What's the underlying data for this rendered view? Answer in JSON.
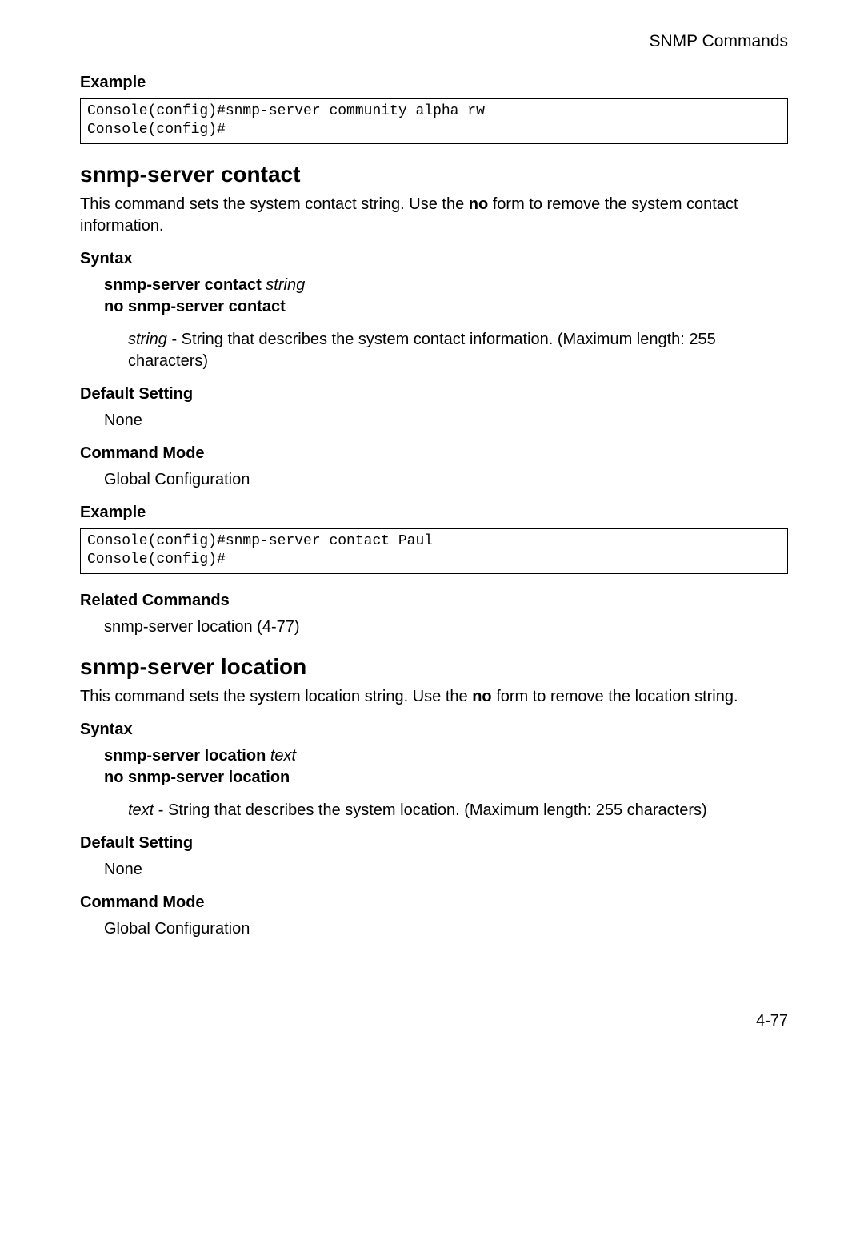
{
  "header": "SNMP Commands",
  "example1_heading": "Example",
  "example1_code": "Console(config)#snmp-server community alpha rw\nConsole(config)#",
  "contact": {
    "title": "snmp-server contact",
    "desc_part1": "This command sets the system contact string. Use the ",
    "desc_bold": "no",
    "desc_part2": " form to remove the system contact information.",
    "syntax_heading": "Syntax",
    "syntax_cmd_bold": "snmp-server contact",
    "syntax_cmd_italic": " string",
    "syntax_no": "no snmp-server contact",
    "param_italic": "string",
    "param_desc": " - String that describes the system contact information. (Maximum length: 255 characters)",
    "default_heading": "Default Setting",
    "default_value": "None",
    "mode_heading": "Command Mode",
    "mode_value": "Global Configuration",
    "example_heading": "Example",
    "example_code": "Console(config)#snmp-server contact Paul\nConsole(config)#",
    "related_heading": "Related Commands",
    "related_value": "snmp-server location (4-77)"
  },
  "location": {
    "title": "snmp-server location",
    "desc_part1": "This command sets the system location string. Use the ",
    "desc_bold": "no",
    "desc_part2": " form to remove the location string.",
    "syntax_heading": "Syntax",
    "syntax_cmd_bold": "snmp-server location",
    "syntax_cmd_italic": " text",
    "syntax_no": "no snmp-server location",
    "param_italic": "text",
    "param_desc": " - String that describes the system location. (Maximum length: 255 characters)",
    "default_heading": "Default Setting",
    "default_value": "None",
    "mode_heading": "Command Mode",
    "mode_value": "Global Configuration"
  },
  "page_number": "4-77"
}
